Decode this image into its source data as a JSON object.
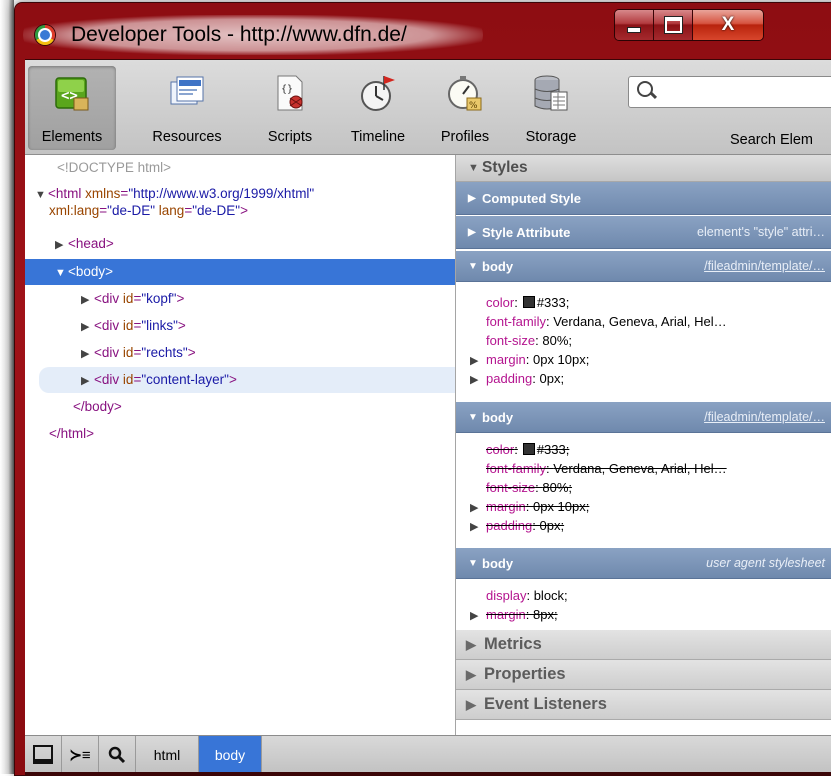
{
  "window": {
    "title": "Developer Tools - http://www.dfn.de/",
    "controls": {
      "minimize": "",
      "maximize": "",
      "close": "X"
    }
  },
  "toolbar": {
    "tools": [
      {
        "label": "Elements",
        "icon": "elements-icon",
        "selected": true
      },
      {
        "label": "Resources",
        "icon": "resources-icon"
      },
      {
        "label": "Scripts",
        "icon": "scripts-icon"
      },
      {
        "label": "Timeline",
        "icon": "timeline-icon"
      },
      {
        "label": "Profiles",
        "icon": "profiles-icon"
      },
      {
        "label": "Storage",
        "icon": "storage-icon"
      }
    ],
    "search": {
      "placeholder": "",
      "caption": "Search Elem"
    }
  },
  "dom_tree": {
    "doctype": "<!DOCTYPE html>",
    "html_open": "<html",
    "html_attr1": "xmlns",
    "html_val1": "\"http://www.w3.org/1999/xhtml\"",
    "html_attr2": "xml:lang",
    "html_val2": "\"de-DE\"",
    "html_attr3": "lang",
    "html_val3": "\"de-DE\"",
    "head": "<head>",
    "body": "<body>",
    "divs": [
      {
        "open": "<div",
        "attr": "id",
        "val": "\"kopf\""
      },
      {
        "open": "<div",
        "attr": "id",
        "val": "\"links\""
      },
      {
        "open": "<div",
        "attr": "id",
        "val": "\"rechts\""
      },
      {
        "open": "<div",
        "attr": "id",
        "val": "\"content-layer\""
      }
    ],
    "body_close": "</body>",
    "html_close": "</html>"
  },
  "sidebar": {
    "styles_title": "Styles",
    "computed_title": "Computed Style",
    "style_attr_title": "Style Attribute",
    "style_attr_note": "element's \"style\" attri…",
    "rules": [
      {
        "selector": "body",
        "source": "/fileadmin/template/…",
        "props": [
          {
            "name": "color",
            "value": "#333;",
            "swatch": true
          },
          {
            "name": "font-family",
            "value": "Verdana, Geneva, Arial, Hel…"
          },
          {
            "name": "font-size",
            "value": "80%;"
          },
          {
            "name": "margin",
            "value": "0px 10px;",
            "expandable": true
          },
          {
            "name": "padding",
            "value": "0px;",
            "expandable": true
          }
        ]
      },
      {
        "selector": "body",
        "source": "/fileadmin/template/…",
        "overridden": true,
        "props": [
          {
            "name": "color",
            "value": "#333;",
            "swatch": true
          },
          {
            "name": "font-family",
            "value": "Verdana, Geneva, Arial, Hel…"
          },
          {
            "name": "font-size",
            "value": "80%;"
          },
          {
            "name": "margin",
            "value": "0px 10px;",
            "expandable": true
          },
          {
            "name": "padding",
            "value": "0px;",
            "expandable": true
          }
        ]
      },
      {
        "selector": "body",
        "source": "user agent stylesheet",
        "props": [
          {
            "name": "display",
            "value": "block;"
          },
          {
            "name": "margin",
            "value": "8px;",
            "expandable": true,
            "struck": true
          }
        ]
      }
    ],
    "collapsed_sections": [
      "Metrics",
      "Properties",
      "Event Listeners"
    ]
  },
  "statusbar": {
    "crumbs": [
      "html",
      "body"
    ]
  }
}
